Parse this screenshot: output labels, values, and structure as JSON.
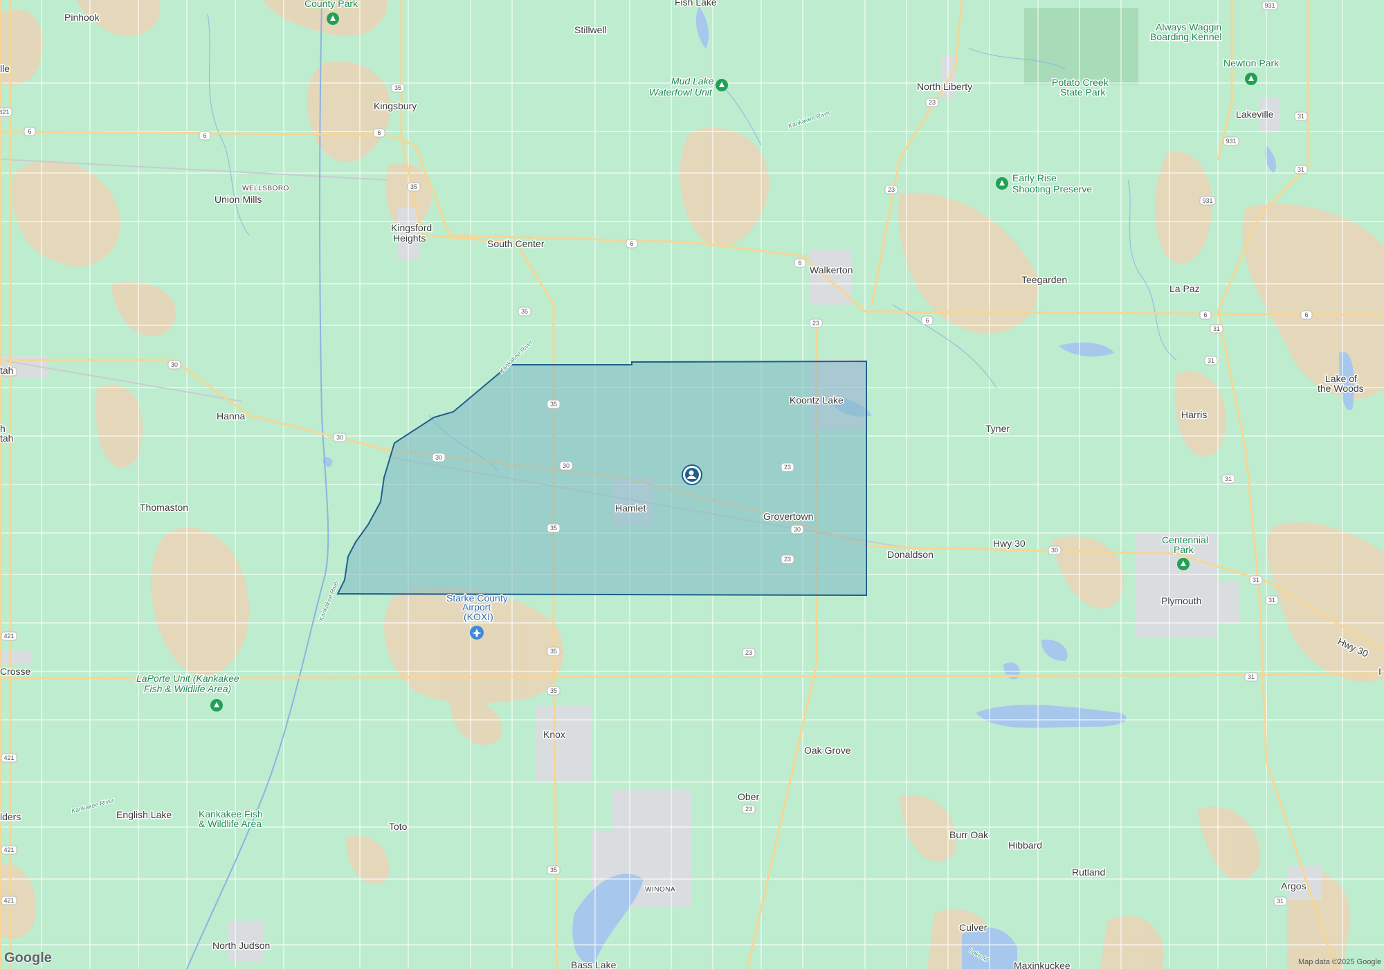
{
  "map": {
    "credit": "Map data ©2025 Google",
    "logo": "Google",
    "region_highlight_color": "#7fb8c4",
    "region_border_color": "#1f5f8b",
    "background_color": "#bdeccf",
    "farmland_color": "#e9d5b7",
    "water_color": "#a8c7ec",
    "road_color": "#f7d694",
    "urban_color": "#dadde0"
  },
  "places": {
    "pinhook": "Pinhook",
    "county_park": "County Park",
    "fish_lake": "Fish Lake",
    "stillwell": "Stillwell",
    "mud_lake_1": "Mud Lake",
    "mud_lake_2": "Waterfowl Unit",
    "north_liberty": "North Liberty",
    "always_waggin_1": "Always Waggin",
    "always_waggin_2": "Boarding Kennel",
    "potato_creek_1": "Potato Creek",
    "potato_creek_2": "State Park",
    "newton_park": "Newton Park",
    "lakeville": "Lakeville",
    "kingsbury": "Kingsbury",
    "wellsboro": "WELLSBORO",
    "union_mills": "Union Mills",
    "kingsford_1": "Kingsford",
    "kingsford_2": "Heights",
    "south_center": "South Center",
    "walkerton": "Walkerton",
    "early_rise_1": "Early Rise",
    "early_rise_2": "Shooting Preserve",
    "teegarden": "Teegarden",
    "la_paz": "La Paz",
    "lake_woods_1": "Lake of",
    "lake_woods_2": "the Woods",
    "westville": "lle",
    "wanatah_1": "tah",
    "wanatah_2": "h",
    "wanatah_3": "tah",
    "hanna": "Hanna",
    "koontz_lake": "Koontz Lake",
    "tyner": "Tyner",
    "harris": "Harris",
    "thomaston": "Thomaston",
    "hamlet": "Hamlet",
    "grovertown": "Grovertown",
    "donaldson": "Donaldson",
    "centennial_1": "Centennial",
    "centennial_2": "Park",
    "plymouth": "Plymouth",
    "airport_1": "Starke County",
    "airport_2": "Airport",
    "airport_3": "(KOXI)",
    "la_crosse": "Crosse",
    "laporte_1": "LaPorte Unit (Kankakee",
    "laporte_2": "Fish & Wildlife Area)",
    "knox": "Knox",
    "oak_grove": "Oak Grove",
    "ober": "Ober",
    "english_lake": "English Lake",
    "kankakee_fw_1": "Kankakee Fish",
    "kankakee_fw_2": "& Wildlife Area",
    "toto": "Toto",
    "burr_oak": "Burr Oak",
    "hibbard": "Hibbard",
    "rutland": "Rutland",
    "argos": "Argos",
    "winona": "WINONA",
    "north_judson": "North Judson",
    "bass_lake": "Bass Lake",
    "culver": "Culver",
    "lake_max": "Lake M",
    "maxinkuckee": "Maxinkuckee",
    "wanders": "lders",
    "right_edge": "I"
  },
  "rivers": {
    "kankakee_1": "Kankakee River",
    "kankakee_2": "Kankakee River",
    "kankakee_3": "Kankakee River",
    "kankakee_4": "Kankakee River"
  },
  "roads": {
    "us6": "6",
    "us35": "35",
    "us30": "30",
    "sr23": "23",
    "us421": "421",
    "us31": "31",
    "sr931": "931",
    "hwy30": "Hwy 30"
  }
}
